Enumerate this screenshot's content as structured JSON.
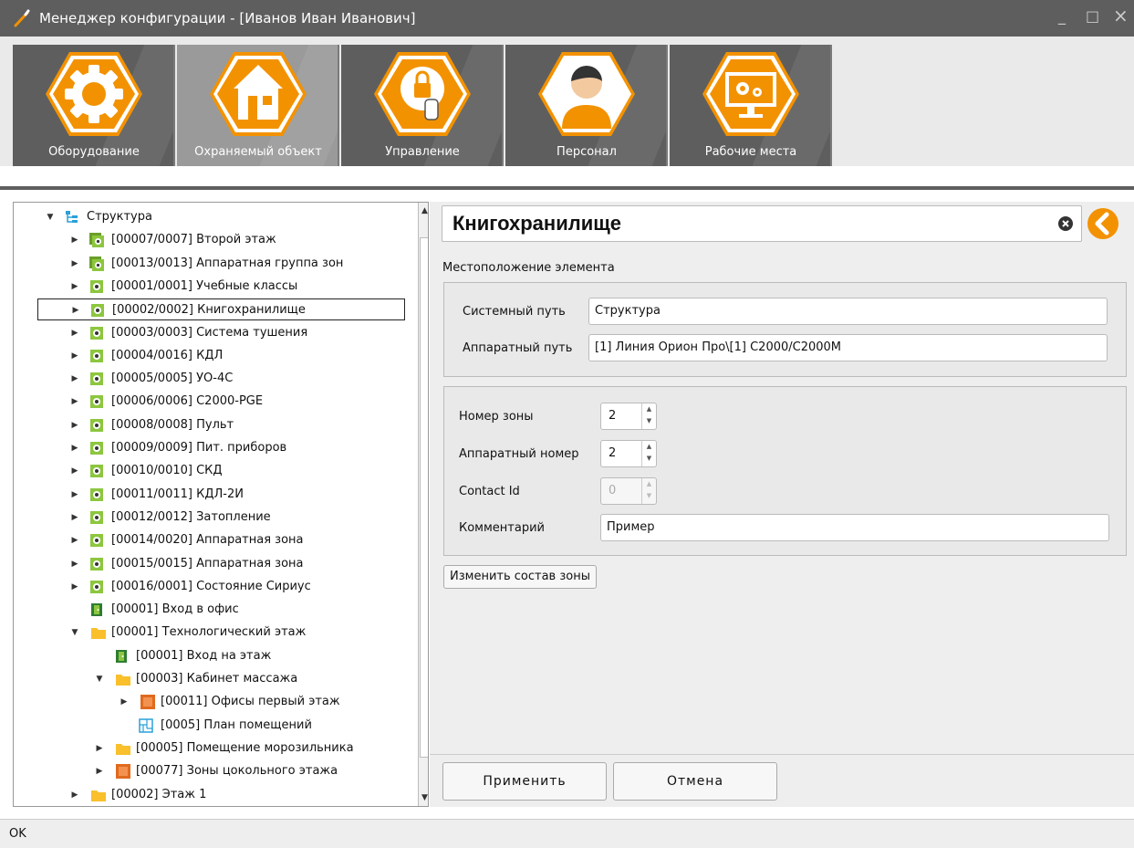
{
  "window": {
    "title": "Менеджер конфигурации - [Иванов Иван Иванович]",
    "min": "_",
    "max": "□",
    "close": "×"
  },
  "toolbar": [
    {
      "label": "Оборудование",
      "icon": "gear-icon",
      "active": false
    },
    {
      "label": "Охраняемый объект",
      "icon": "house-icon",
      "active": true
    },
    {
      "label": "Управление",
      "icon": "lock-gear-icon",
      "active": false
    },
    {
      "label": "Персонал",
      "icon": "person-icon",
      "active": false
    },
    {
      "label": "Рабочие места",
      "icon": "monitor-icon",
      "active": false
    }
  ],
  "tree": [
    {
      "label": "Структура",
      "level": 0,
      "arrow": "down",
      "icon": "structure-icon"
    },
    {
      "label": "[00007/0007] Второй этаж",
      "level": 1,
      "arrow": "right",
      "icon": "zone-group-icon"
    },
    {
      "label": "[00013/0013] Аппаратная группа зон",
      "level": 1,
      "arrow": "right",
      "icon": "zone-group-icon"
    },
    {
      "label": "[00001/0001] Учебные классы",
      "level": 1,
      "arrow": "right",
      "icon": "zone-icon"
    },
    {
      "label": "[00002/0002] Книгохранилище",
      "level": 1,
      "arrow": "right",
      "icon": "zone-icon",
      "selected": true
    },
    {
      "label": "[00003/0003] Система тушения",
      "level": 1,
      "arrow": "right",
      "icon": "zone-icon"
    },
    {
      "label": "[00004/0016] КДЛ",
      "level": 1,
      "arrow": "right",
      "icon": "zone-icon"
    },
    {
      "label": "[00005/0005] УО-4С",
      "level": 1,
      "arrow": "right",
      "icon": "zone-icon"
    },
    {
      "label": "[00006/0006] С2000-PGE",
      "level": 1,
      "arrow": "right",
      "icon": "zone-icon"
    },
    {
      "label": "[00008/0008] Пульт",
      "level": 1,
      "arrow": "right",
      "icon": "zone-icon"
    },
    {
      "label": "[00009/0009] Пит. приборов",
      "level": 1,
      "arrow": "right",
      "icon": "zone-icon"
    },
    {
      "label": "[00010/0010] СКД",
      "level": 1,
      "arrow": "right",
      "icon": "zone-icon"
    },
    {
      "label": "[00011/0011] КДЛ-2И",
      "level": 1,
      "arrow": "right",
      "icon": "zone-icon"
    },
    {
      "label": "[00012/0012] Затопление",
      "level": 1,
      "arrow": "right",
      "icon": "zone-icon"
    },
    {
      "label": "[00014/0020] Аппаратная зона",
      "level": 1,
      "arrow": "right",
      "icon": "zone-icon"
    },
    {
      "label": "[00015/0015] Аппаратная зона",
      "level": 1,
      "arrow": "right",
      "icon": "zone-icon"
    },
    {
      "label": "[00016/0001] Состояние Сириус",
      "level": 1,
      "arrow": "right",
      "icon": "zone-icon"
    },
    {
      "label": "[00001] Вход в офис",
      "level": 1,
      "arrow": "",
      "icon": "door-icon"
    },
    {
      "label": "[00001] Технологический этаж",
      "level": 1,
      "arrow": "down",
      "icon": "folder-icon"
    },
    {
      "label": "[00001] Вход на этаж",
      "level": 2,
      "arrow": "",
      "icon": "door-icon"
    },
    {
      "label": "[00003] Кабинет массажа",
      "level": 2,
      "arrow": "down",
      "icon": "folder-icon"
    },
    {
      "label": "[00011] Офисы первый этаж",
      "level": 3,
      "arrow": "right",
      "icon": "orange-zone-icon"
    },
    {
      "label": "[0005] План помещений",
      "level": 3,
      "arrow": "",
      "icon": "plan-icon"
    },
    {
      "label": "[00005] Помещение морозильника",
      "level": 2,
      "arrow": "right",
      "icon": "folder-icon"
    },
    {
      "label": "[00077] Зоны цокольного этажа",
      "level": 2,
      "arrow": "right",
      "icon": "orange-zone-icon"
    },
    {
      "label": "[00002] Этаж 1",
      "level": 1,
      "arrow": "right",
      "icon": "folder-icon"
    }
  ],
  "detail": {
    "name": "Книгохранилище",
    "location_label": "Местоположение элемента",
    "system_path_label": "Системный путь",
    "system_path": "Структура",
    "hw_path_label": "Аппаратный путь",
    "hw_path": "[1] Линия Орион Про\\[1] С2000/С2000М",
    "zone_number_label": "Номер зоны",
    "zone_number": "2",
    "hw_number_label": "Аппаратный номер",
    "hw_number": "2",
    "contact_id_label": "Contact Id",
    "contact_id": "0",
    "comment_label": "Комментарий",
    "comment": "Пример",
    "change_zone_button": "Изменить состав зоны",
    "apply_button": "Применить",
    "cancel_button": "Отмена"
  },
  "status": "OK",
  "colors": {
    "accent": "#f39200",
    "zone_green": "#8dc63f",
    "titlebar": "#5e5e5e"
  }
}
